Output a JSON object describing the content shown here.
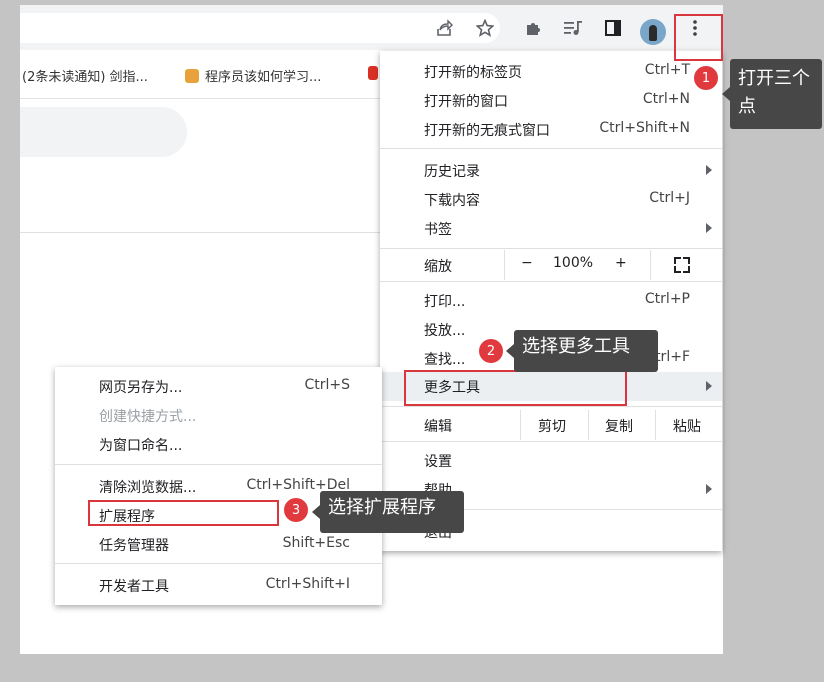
{
  "bookmarks": [
    {
      "label": "(2条未读通知) 剑指..."
    },
    {
      "label": "程序员该如何学习..."
    }
  ],
  "main_menu": {
    "new_tab": {
      "label": "打开新的标签页",
      "shortcut": "Ctrl+T"
    },
    "new_window": {
      "label": "打开新的窗口",
      "shortcut": "Ctrl+N"
    },
    "incognito": {
      "label": "打开新的无痕式窗口",
      "shortcut": "Ctrl+Shift+N"
    },
    "history": {
      "label": "历史记录"
    },
    "downloads": {
      "label": "下载内容",
      "shortcut": "Ctrl+J"
    },
    "bookmarks": {
      "label": "书签"
    },
    "zoom": {
      "label": "缩放",
      "minus": "−",
      "value": "100%",
      "plus": "+"
    },
    "print": {
      "label": "打印...",
      "shortcut": "Ctrl+P"
    },
    "cast": {
      "label": "投放..."
    },
    "find": {
      "label": "查找...",
      "shortcut": "Ctrl+F"
    },
    "more_tools": {
      "label": "更多工具"
    },
    "edit": {
      "label": "编辑",
      "cut": "剪切",
      "copy": "复制",
      "paste": "粘贴"
    },
    "settings": {
      "label": "设置"
    },
    "help": {
      "label": "帮助"
    },
    "exit": {
      "label": "退出"
    }
  },
  "sub_menu": {
    "save_page": {
      "label": "网页另存为...",
      "shortcut": "Ctrl+S"
    },
    "create_shortcut": {
      "label": "创建快捷方式..."
    },
    "name_window": {
      "label": "为窗口命名..."
    },
    "clear_data": {
      "label": "清除浏览数据...",
      "shortcut": "Ctrl+Shift+Del"
    },
    "extensions": {
      "label": "扩展程序"
    },
    "task_manager": {
      "label": "任务管理器",
      "shortcut": "Shift+Esc"
    },
    "dev_tools": {
      "label": "开发者工具",
      "shortcut": "Ctrl+Shift+I"
    }
  },
  "annotations": {
    "step1": {
      "number": "1",
      "text": "打开三个点"
    },
    "step2": {
      "number": "2",
      "text": "选择更多工具"
    },
    "step3": {
      "number": "3",
      "text": "选择扩展程序"
    }
  },
  "colors": {
    "highlight": "#d9363e",
    "tooltip_bg": "#474747"
  }
}
